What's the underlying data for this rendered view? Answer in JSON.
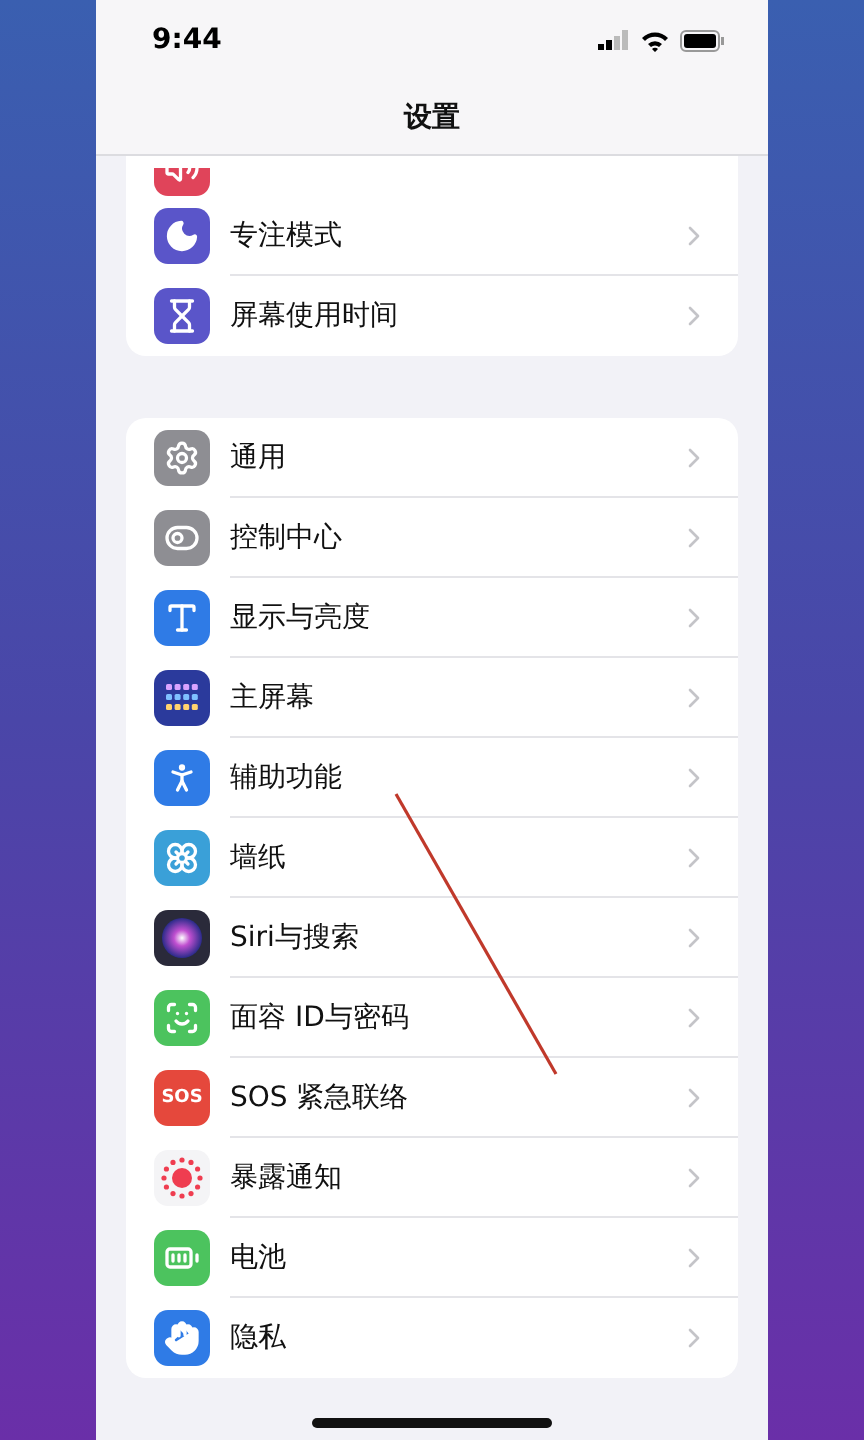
{
  "status_bar": {
    "time": "9:44"
  },
  "nav": {
    "title": "设置"
  },
  "groups": [
    {
      "partial_top": {
        "kind": "sound",
        "color": "#e0445a"
      },
      "items": [
        {
          "kind": "focus",
          "color": "#5a55c9",
          "label": "专注模式"
        },
        {
          "kind": "screen_time",
          "color": "#5a55c9",
          "label": "屏幕使用时间"
        }
      ]
    },
    {
      "items": [
        {
          "kind": "general",
          "color": "#8e8e93",
          "label": "通用"
        },
        {
          "kind": "control_center",
          "color": "#8e8e93",
          "label": "控制中心"
        },
        {
          "kind": "display",
          "color": "#2f7be6",
          "label": "显示与亮度"
        },
        {
          "kind": "home_screen",
          "color": "#2b3a9c",
          "label": "主屏幕"
        },
        {
          "kind": "accessibility",
          "color": "#2f7be6",
          "label": "辅助功能"
        },
        {
          "kind": "wallpaper",
          "color": "#3aa0d8",
          "label": "墙纸"
        },
        {
          "kind": "siri",
          "color": "#2a2a3a",
          "label": "Siri与搜索"
        },
        {
          "kind": "face_id",
          "color": "#4cc35e",
          "label": "面容 ID与密码"
        },
        {
          "kind": "sos",
          "color": "#e5483c",
          "label": "SOS 紧急联络",
          "icon_text": "SOS"
        },
        {
          "kind": "exposure",
          "color": "#f4f4f6",
          "label": "暴露通知"
        },
        {
          "kind": "battery",
          "color": "#4cc35e",
          "label": "电池"
        },
        {
          "kind": "privacy",
          "color": "#2f7be6",
          "label": "隐私"
        }
      ]
    }
  ]
}
